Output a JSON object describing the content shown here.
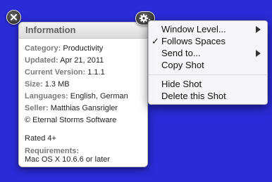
{
  "info_window": {
    "title": "Information",
    "rows": [
      {
        "label": "Category:",
        "value": "Productivity"
      },
      {
        "label": "Updated:",
        "value": "Apr 21, 2011"
      },
      {
        "label": "Current Version:",
        "value": "1.1.1"
      },
      {
        "label": "Size:",
        "value": "1.3 MB"
      },
      {
        "label": "Languages:",
        "value": "English, German"
      },
      {
        "label": "Seller:",
        "value": "Matthias Gansrigler"
      }
    ],
    "copyright": "© Eternal Storms Software",
    "rating": "Rated 4+",
    "requirements_label": "Requirements:",
    "requirements_value": "Mac OS X 10.6.6 or later"
  },
  "controls": {
    "close_icon": "close-icon",
    "gear_icon": "gear-icon"
  },
  "context_menu": {
    "items": [
      {
        "label": "Window Level...",
        "checked": false,
        "submenu": true
      },
      {
        "label": "Follows Spaces",
        "checked": true,
        "submenu": false
      },
      {
        "label": "Send to...",
        "checked": false,
        "submenu": true
      },
      {
        "label": "Copy Shot",
        "checked": false,
        "submenu": false
      },
      {
        "label": "Hide Shot",
        "checked": false,
        "submenu": false
      },
      {
        "label": "Delete this Shot",
        "checked": false,
        "submenu": false
      }
    ],
    "check_glyph": "✓"
  },
  "colors": {
    "desktop_background": "#2b2bd8",
    "label_gray": "#7a7a7a"
  }
}
